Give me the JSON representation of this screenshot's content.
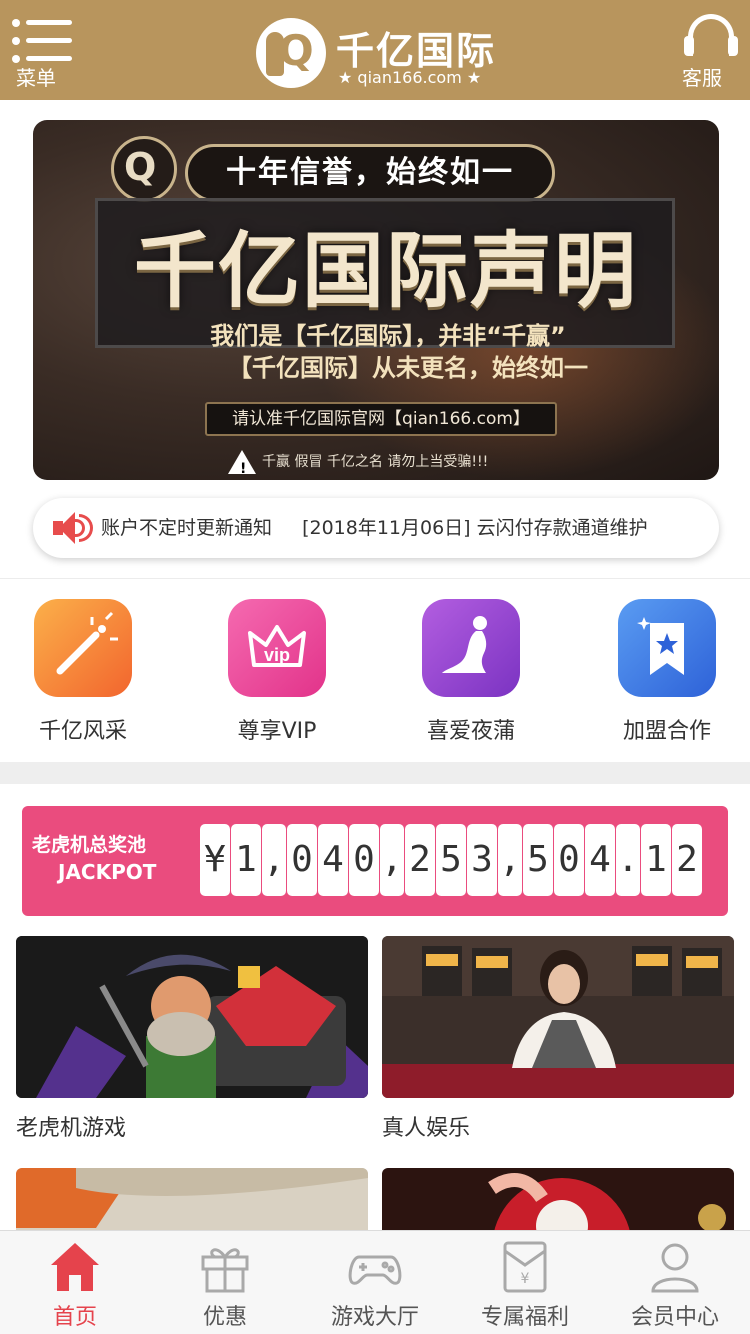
{
  "header": {
    "menu_label": "菜单",
    "logo_mark": "Q",
    "brand": "千亿国际",
    "domain": "★ qian166.com ★",
    "service_label": "客服",
    "background": "#b8955d"
  },
  "banner": {
    "badge_text": "Q",
    "tagline": "十年信誉，始终如一",
    "title": "千亿国际声明",
    "line1": "我们是【千亿国际】，并非“千赢”",
    "line2": "【千亿国际】从未更名，始终如一",
    "site": "请认准千亿国际官网【qian166.com】",
    "warning_icon": "!",
    "warning": "千赢 假冒 千亿之名 请勿上当受骗!!!"
  },
  "notice": {
    "icon": "speaker-icon",
    "items": [
      "账户不定时更新通知",
      "[2018年11月06日] 云闪付存款通道维护"
    ]
  },
  "quick_links": [
    {
      "label": "千亿风采",
      "icon": "magic-wand-icon",
      "color": "#f8763a"
    },
    {
      "label": "尊享VIP",
      "icon": "vip-crown-icon",
      "color": "#f0459a"
    },
    {
      "label": "喜爱夜蒲",
      "icon": "dancer-icon",
      "color": "#9a45d1"
    },
    {
      "label": "加盟合作",
      "icon": "star-bookmark-icon",
      "color": "#3f7ee8"
    }
  ],
  "jackpot": {
    "label_cn": "老虎机总奖池",
    "label_en": "JACKPOT",
    "digits": [
      "¥",
      "1",
      ",",
      "0",
      "4",
      "0",
      ",",
      "2",
      "5",
      "3",
      ",",
      "5",
      "0",
      "4",
      ".",
      "1",
      "2"
    ],
    "color": "#ea4c7e"
  },
  "games": [
    {
      "label": "老虎机游戏"
    },
    {
      "label": "真人娱乐"
    },
    {
      "label": ""
    },
    {
      "label": ""
    }
  ],
  "tabbar": {
    "active_color": "#e5434c",
    "tabs": [
      {
        "label": "首页",
        "icon": "home-icon",
        "active": true
      },
      {
        "label": "优惠",
        "icon": "gift-icon",
        "active": false
      },
      {
        "label": "游戏大厅",
        "icon": "gamepad-icon",
        "active": false
      },
      {
        "label": "专属福利",
        "icon": "red-envelope-icon",
        "active": false
      },
      {
        "label": "会员中心",
        "icon": "user-icon",
        "active": false
      }
    ]
  }
}
